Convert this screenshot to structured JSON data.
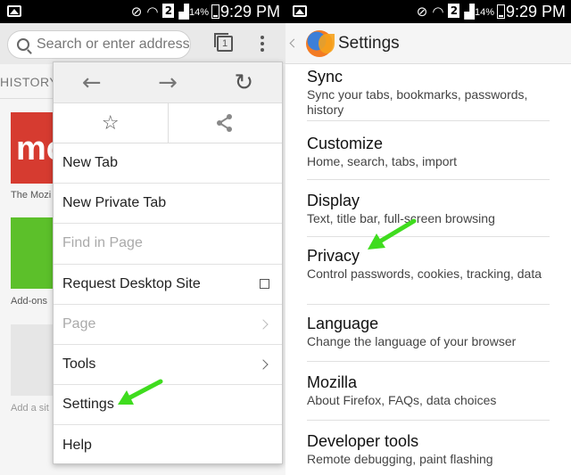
{
  "status_bar": {
    "battery": "14%",
    "time": "9:29 PM",
    "sim_badge": "2"
  },
  "left": {
    "url_placeholder": "Search or enter address",
    "tab_count": "1",
    "history_tab": "HISTORY",
    "tiles": [
      {
        "label": "The Mozi",
        "text": "mo",
        "color": "#d63b30"
      },
      {
        "label": "Add-ons",
        "color": "#5cc02a"
      },
      {
        "label": "Add a sit",
        "color": "#e6e6e6"
      }
    ],
    "menu": {
      "nav_icons": [
        "back-arrow-icon",
        "forward-arrow-icon",
        "reload-icon"
      ],
      "action_icons": [
        "star-icon",
        "share-icon"
      ],
      "items": [
        {
          "label": "New Tab",
          "enabled": true
        },
        {
          "label": "New Private Tab",
          "enabled": true
        },
        {
          "label": "Find in Page",
          "enabled": false
        },
        {
          "label": "Request Desktop Site",
          "enabled": true,
          "checkbox": true
        },
        {
          "label": "Page",
          "enabled": false,
          "submenu": true
        },
        {
          "label": "Tools",
          "enabled": true,
          "submenu": true
        },
        {
          "label": "Settings",
          "enabled": true
        },
        {
          "label": "Help",
          "enabled": true
        }
      ]
    }
  },
  "right": {
    "title": "Settings",
    "items": [
      {
        "title": "Sync",
        "subtitle": "Sync your tabs, bookmarks, passwords, history"
      },
      {
        "title": "Customize",
        "subtitle": "Home, search, tabs, import"
      },
      {
        "title": "Display",
        "subtitle": "Text, title bar, full-screen browsing"
      },
      {
        "title": "Privacy",
        "subtitle": "Control passwords, cookies, tracking, data"
      },
      {
        "title": "Language",
        "subtitle": "Change the language of your browser"
      },
      {
        "title": "Mozilla",
        "subtitle": "About Firefox, FAQs, data choices"
      },
      {
        "title": "Developer tools",
        "subtitle": "Remote debugging, paint flashing"
      }
    ]
  },
  "colors": {
    "arrow_green": "#3fdc1e",
    "status_bar": "#000000",
    "toolbar": "#e9e9e9"
  }
}
